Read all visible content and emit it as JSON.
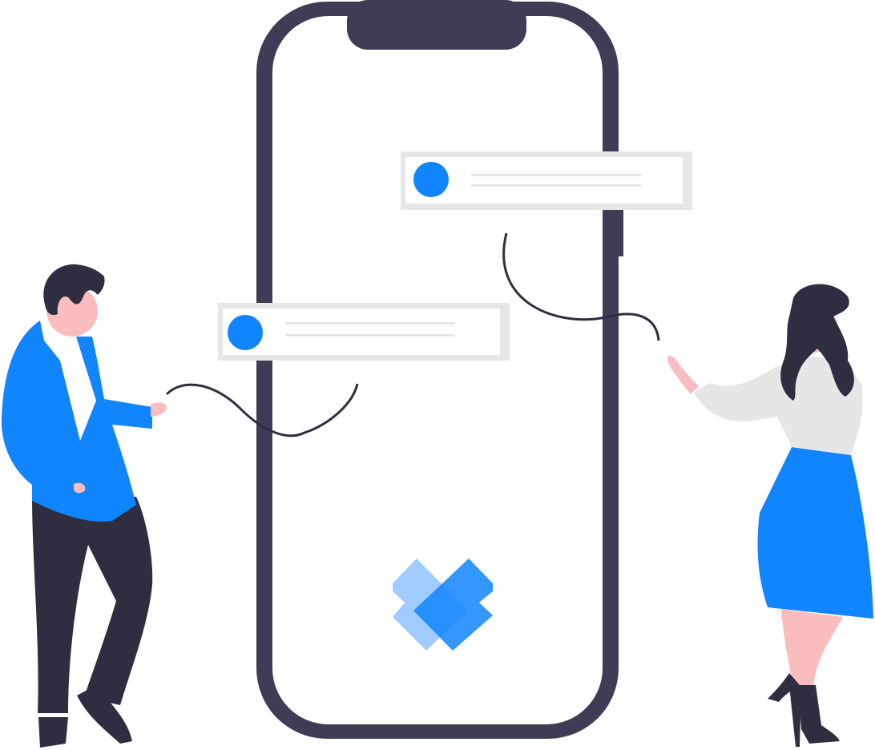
{
  "colors": {
    "phone_frame": "#3f3d56",
    "screen_bg": "#ffffff",
    "accent_blue": "#1185fe",
    "light_blue": "#8fc3ff",
    "card_border": "#e6e6e6",
    "card_line": "#e6e6e6",
    "skin": "#f9bcbf",
    "hair_dark": "#2f2e41",
    "pants_dark": "#2f2e41",
    "blouse_grey": "#e6e6e6",
    "string": "#2f2e41"
  },
  "icons": {
    "logo": "blue-diamond-heart-logo",
    "chat_avatar": "blue-circle-avatar"
  },
  "message_cards": [
    {
      "id": "top",
      "avatar": "blue-circle-avatar",
      "text_lines": 2
    },
    {
      "id": "bottom",
      "avatar": "blue-circle-avatar",
      "text_lines": 2
    }
  ],
  "figures": [
    {
      "id": "man",
      "description_icon": "man-figure"
    },
    {
      "id": "woman",
      "description_icon": "woman-figure"
    }
  ]
}
